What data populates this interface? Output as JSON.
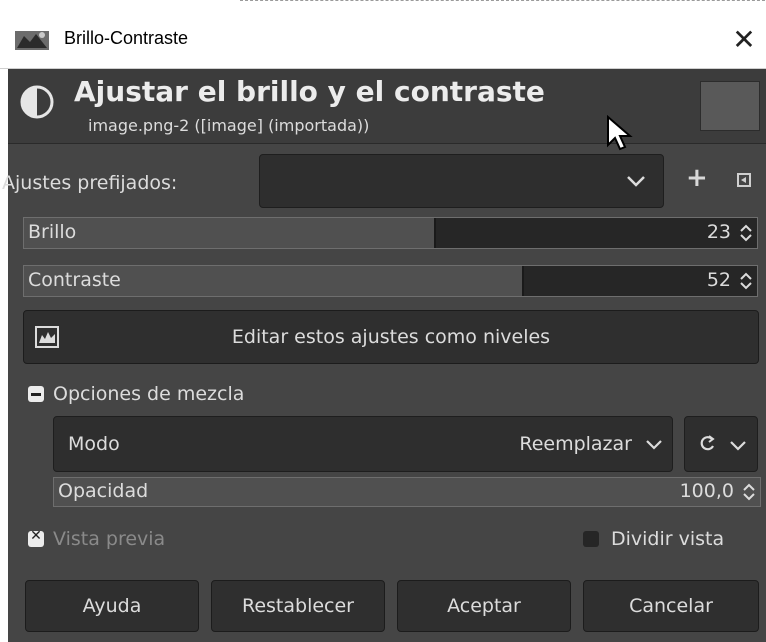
{
  "window": {
    "title": "Brillo-Contraste",
    "close_glyph": "✕"
  },
  "header": {
    "title": "Ajustar el brillo y el contraste",
    "subtitle": "image.png-2 ([image] (importada))"
  },
  "presets": {
    "label": "Ajustes prefijados:",
    "value": "",
    "add_glyph": "+"
  },
  "brightness": {
    "label": "Brillo",
    "value": "23",
    "level_fraction": 0.56
  },
  "contrast": {
    "label": "Contraste",
    "value": "52",
    "level_fraction": 0.68
  },
  "levels_button": {
    "label": "Editar estos ajustes como niveles",
    "icon": "levels-icon"
  },
  "blend": {
    "label": "Opciones de mezcla",
    "expanded": true,
    "mode_label": "Modo",
    "mode_value": "Reemplazar",
    "opacity_label": "Opacidad",
    "opacity_value": "100,0"
  },
  "preview": {
    "label": "Vista previa",
    "checked": true
  },
  "split_view": {
    "label": "Dividir vista",
    "checked": false
  },
  "buttons": {
    "help": "Ayuda",
    "reset": "Restablecer",
    "ok": "Aceptar",
    "cancel": "Cancelar"
  },
  "colors": {
    "dialog_bg": "#454545",
    "field_bg": "#262626",
    "slider_fill": "#505050",
    "text": "#dcdcdc"
  }
}
